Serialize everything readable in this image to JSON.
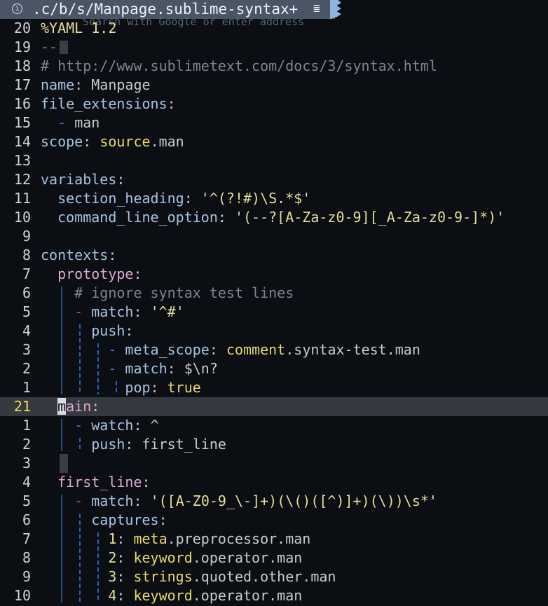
{
  "tab": {
    "info_icon": "info-icon",
    "title": ".c/b/s/Manpage.sublime-syntax+",
    "menu_icon": "hamburger-icon",
    "url_hint": "Search with Google or enter address"
  },
  "lines": [
    {
      "num": "20",
      "code": "%YAML 1.2"
    },
    {
      "num": "19",
      "code": "---"
    },
    {
      "num": "18",
      "code": "# http://www.sublimetext.com/docs/3/syntax.html"
    },
    {
      "num": "17",
      "code": "name: Manpage"
    },
    {
      "num": "16",
      "code": "file_extensions:"
    },
    {
      "num": "15",
      "code": "  - man"
    },
    {
      "num": "14",
      "code": "scope: source.man"
    },
    {
      "num": "13",
      "code": ""
    },
    {
      "num": "12",
      "code": "variables:"
    },
    {
      "num": "11",
      "code": "  section_heading: '^(?!#)\\S.*$'"
    },
    {
      "num": "10",
      "code": "  command_line_option: '(--?[A-Za-z0-9][_A-Za-z0-9-]*)'"
    },
    {
      "num": "9",
      "code": ""
    },
    {
      "num": "8",
      "code": "contexts:"
    },
    {
      "num": "7",
      "code": "  prototype:"
    },
    {
      "num": "6",
      "code": "    # ignore syntax test lines"
    },
    {
      "num": "5",
      "code": "    - match: '^#'"
    },
    {
      "num": "4",
      "code": "      push:"
    },
    {
      "num": "3",
      "code": "        - meta_scope: comment.syntax-test.man"
    },
    {
      "num": "2",
      "code": "        - match: $\\n?"
    },
    {
      "num": "1",
      "code": "          pop: true"
    },
    {
      "num": "21",
      "code": "  main:"
    },
    {
      "num": "1",
      "code": "    - watch: ^"
    },
    {
      "num": "2",
      "code": "      push: first_line"
    },
    {
      "num": "3",
      "code": ""
    },
    {
      "num": "4",
      "code": "  first_line:"
    },
    {
      "num": "5",
      "code": "    - match: '([A-Z0-9_\\-]+)(\\()([^)]+)(\\))\\s*'"
    },
    {
      "num": "6",
      "code": "      captures:"
    },
    {
      "num": "7",
      "code": "        1: meta.preprocessor.man"
    },
    {
      "num": "8",
      "code": "        2: keyword.operator.man"
    },
    {
      "num": "9",
      "code": "        3: strings.quoted.other.man"
    },
    {
      "num": "10",
      "code": "        4: keyword.operator.man"
    }
  ],
  "current_line_index": 20,
  "colors": {
    "background": "#0b0e13",
    "tab": "#4a5566",
    "current_line": "#363a40",
    "current_line_number": "#f3d95a",
    "key": "#a7c4e4",
    "context_key": "#e0a8d4",
    "string": "#e9dd9c",
    "scope_head": "#e9d96f",
    "comment": "#7b8593",
    "indent_guide": "#3b7fd9"
  }
}
